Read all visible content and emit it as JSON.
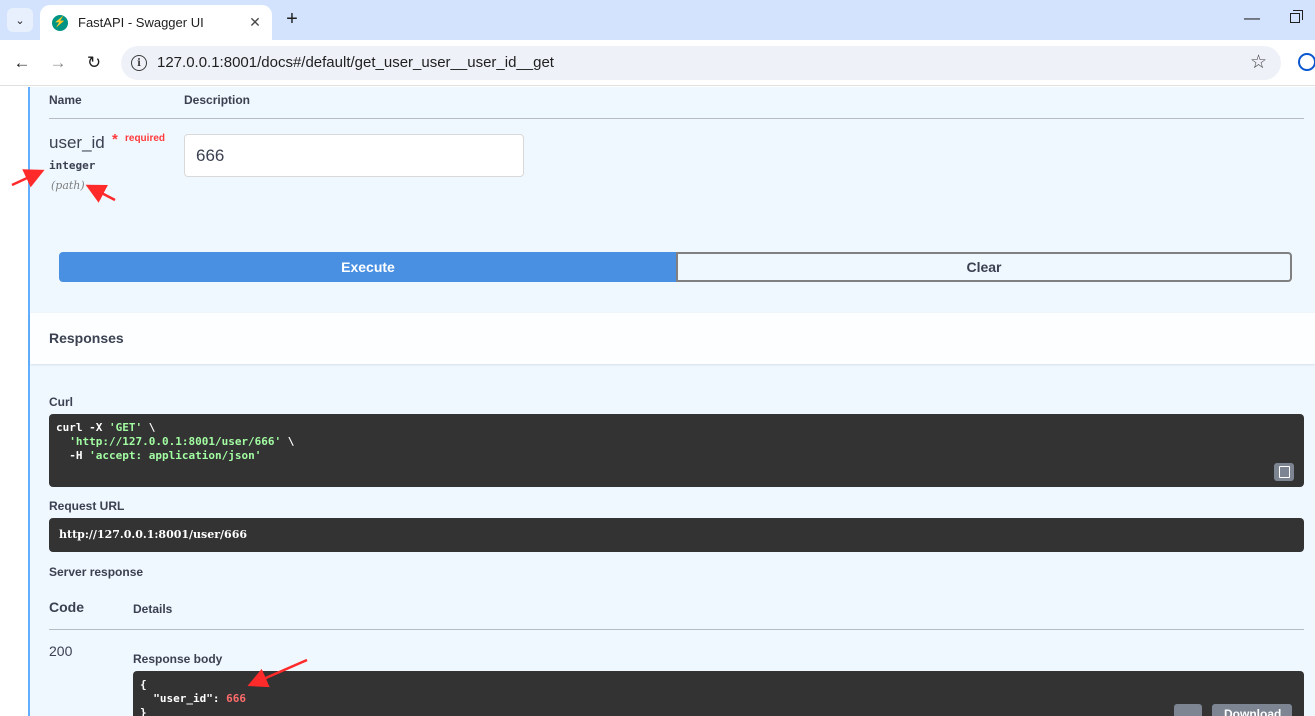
{
  "browser": {
    "tab_title": "FastAPI - Swagger UI",
    "tab_close": "✕",
    "new_tab": "+",
    "url": "127.0.0.1:8001/docs#/default/get_user_user__user_id__get",
    "back": "←",
    "forward": "→",
    "reload": "↻",
    "star": "☆",
    "tab_list": "⌄",
    "minimize": "—"
  },
  "parameters": {
    "headers": {
      "name": "Name",
      "description": "Description"
    },
    "param": {
      "name": "user_id",
      "required_star": "*",
      "required": "required",
      "type": "integer",
      "location": "(path)",
      "value": "666"
    }
  },
  "actions": {
    "execute": "Execute",
    "clear": "Clear"
  },
  "responses": {
    "title": "Responses",
    "curl_label": "Curl",
    "curl_lines": [
      {
        "plain": "curl -X ",
        "str": "'GET'",
        "tail": " \\"
      },
      {
        "plain": "  ",
        "str": "'http://127.0.0.1:8001/user/666'",
        "tail": " \\"
      },
      {
        "plain": "  -H ",
        "str": "'accept: application/json'",
        "tail": ""
      }
    ],
    "request_url_label": "Request URL",
    "request_url": "http://127.0.0.1:8001/user/666",
    "server_response_label": "Server response",
    "code_header": "Code",
    "details_header": "Details",
    "code": "200",
    "body_label": "Response body",
    "body_lines": [
      {
        "text": "{",
        "value": ""
      },
      {
        "text": "  \"user_id\": ",
        "value": "666"
      },
      {
        "text": "}",
        "value": ""
      }
    ],
    "download_label": "Download"
  },
  "colors": {
    "get_accent": "#61affe",
    "execute": "#4990e2",
    "code_bg": "#333333",
    "annotation_arrow": "#ff2a2a"
  }
}
